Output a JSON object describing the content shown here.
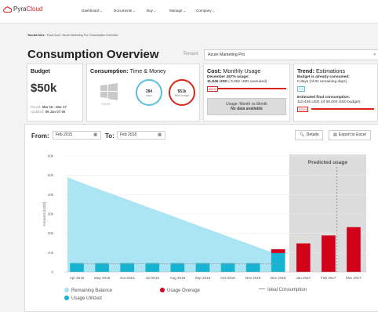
{
  "app": {
    "logo": "PyraCloud",
    "logo_prefix": "Pyra",
    "logo_suffix": "Cloud",
    "brand_color": "#d9261c"
  },
  "nav": {
    "items": [
      "Dashboard",
      "Documents",
      "Buy",
      "Manage",
      "Company"
    ]
  },
  "breadcrumb": {
    "prefix": "You are here :",
    "path": "PyraCloud › Azure Marketing Pro Consumption Overview"
  },
  "page": {
    "title": "Consumption Overview",
    "tenant_label": "Tenant",
    "tenant_value": "Azure Marketing Pro"
  },
  "budget": {
    "title": "Budget",
    "value": "$50k",
    "period_label": "Period:",
    "period_value": "Mar 16 - Mar 17",
    "updated_label": "Updated:",
    "updated_value": "09 Jan 07:00"
  },
  "consumption": {
    "title_bold": "Consumption:",
    "title_rest": " Time & Money",
    "platform": "Azure",
    "days_value": "284",
    "days_unit": "days",
    "budget_value": "$51k",
    "budget_unit": "$50k budget",
    "days_ring_color": "#5bc0de",
    "budget_ring_color": "#d9261c"
  },
  "cost": {
    "title_bold": "Cost:",
    "title_rest": " Monthly Usage",
    "usage_line": "December 457% usage:",
    "usage_detail_bold": "11,846 USD",
    "usage_detail_rest": " ( 9,252 USD overused)",
    "badge": "457%",
    "box_line1": "Usage: Month vs Month",
    "box_line2": "No data available"
  },
  "trend": {
    "title_bold": "Trend:",
    "title_rest": " Estimations",
    "consumed_label": "Budget is already consumed:",
    "consumed_value": "0 days (of 81 remaining days)",
    "consumed_badge": "0%",
    "final_label": "Estimated final consumption:",
    "final_value": "110,435 USD (of 50,000 USD budget)",
    "final_badge": "221%"
  },
  "controls": {
    "from_label": "From:",
    "from_value": "Feb 2015",
    "to_label": "To:",
    "to_value": "Feb 2018",
    "details_label": "Details",
    "export_label": "Export to Excel"
  },
  "chart_data": {
    "type": "bar",
    "ylabel": "Amount (USD)",
    "ylim": [
      0,
      60000
    ],
    "yticks": [
      "0",
      "10k",
      "20k",
      "30k",
      "40k",
      "50k",
      "60k"
    ],
    "categories": [
      "Apr 2016",
      "May 2016",
      "Jun 2016",
      "Jul 2016",
      "Aug 2016",
      "Sep 2016",
      "Oct 2016",
      "Nov 2016",
      "Dec 2016",
      "Jan 2017",
      "Feb 2017",
      "Mar 2017"
    ],
    "series": [
      {
        "name": "Remaining Balance",
        "type": "area",
        "color": "#a6e3f2",
        "values": [
          49000,
          44000,
          39300,
          34500,
          29800,
          25000,
          20200,
          15500,
          10800,
          null,
          null,
          null
        ]
      },
      {
        "name": "Usage Utilized",
        "color": "#17b3d3",
        "values": [
          4600,
          4600,
          4600,
          4600,
          4600,
          4600,
          4600,
          4600,
          9800,
          null,
          null,
          null
        ]
      },
      {
        "name": "Usage Overage",
        "color": "#d0021b",
        "values": [
          null,
          null,
          null,
          null,
          null,
          null,
          null,
          null,
          2000,
          14800,
          18900,
          23200
        ]
      },
      {
        "name": "Ideal Consumption",
        "type": "line",
        "color": "#999999",
        "values": [
          4300,
          4300,
          4300,
          4300,
          4300,
          4300,
          4300,
          4300,
          4300,
          null,
          null,
          null
        ]
      }
    ],
    "annotation": "Predicted usage",
    "predicted_from_index": 9,
    "grid": true
  },
  "legend": [
    {
      "label": "Remaining Balance",
      "color": "#a6e3f2"
    },
    {
      "label": "Usage Overage",
      "color": "#d0021b"
    },
    {
      "label": "Ideal Consumption",
      "color": "#999999"
    },
    {
      "label": "Usage Utilized",
      "color": "#17b3d3"
    }
  ]
}
